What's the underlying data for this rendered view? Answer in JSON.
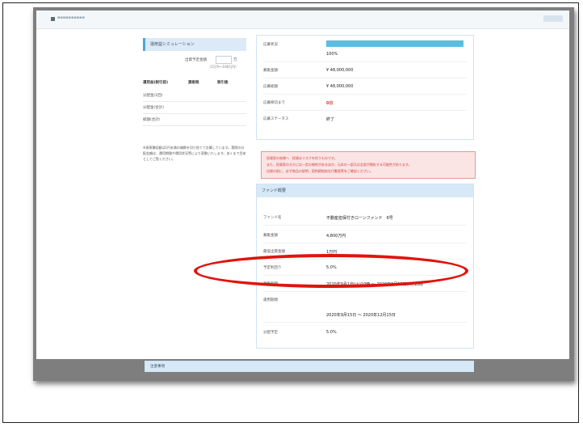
{
  "page": {
    "logo_text": "▪▪▪▪▪▪▪▪▪▪",
    "topbar_right": ""
  },
  "simulation": {
    "title": "運用益シミュレーション",
    "amount_label": "出資予定金額",
    "amount_value": "",
    "amount_unit": "万",
    "amount_note": "（1万円〜100万円）",
    "columns": [
      "運用益(税引前)",
      "源泉税",
      "税引後"
    ],
    "rows": [
      {
        "label": "分配金(1回)",
        "c2": "",
        "c3": ""
      },
      {
        "label": "分配金(合計)",
        "c2": "",
        "c3": ""
      },
      {
        "label": "総額(合計)",
        "c2": "",
        "c3": ""
      }
    ],
    "note": "※源泉徴収額は1円未満の端数を切り捨てて計算しています。実際の分配金額は、運用期間や運用状況等により変動いたします。あくまで目安としてご覧ください。"
  },
  "progress_card": {
    "fill_percent": 100,
    "rows": [
      {
        "label": "応募状況",
        "value": ""
      },
      {
        "label": "",
        "value": "100%"
      },
      {
        "label": "募集金額",
        "value": "¥ 48,000,000"
      },
      {
        "label": "応募総額",
        "value": "¥ 48,000,000"
      },
      {
        "label": "応募締切まで",
        "value": "0日"
      },
      {
        "label": "応募ステータス",
        "value": "終了"
      }
    ]
  },
  "alert": {
    "lines": [
      "投資家の皆様へ　投資はリスクを伴うものです。",
      "また、投資家の方々には一定の制約があるほか、元本の一部又は全部が損失する可能性があります。",
      "出資の前に、必ず商品の説明、契約締結前交付書面等をご確認ください。"
    ]
  },
  "fund_card": {
    "title": "ファンド概要",
    "rows": [
      {
        "label": "ファンド名",
        "value": "不動産担保付きローンファンド　6号"
      },
      {
        "label": "募集金額",
        "value": "4,800万円"
      },
      {
        "label": "最低出資金額",
        "value": "1万円"
      },
      {
        "label": "予定利回り",
        "value": "5.0%"
      },
      {
        "label": "募集期間",
        "value": "2020年9月1日(火)10時 〜 2020年9月10日(木)18時"
      },
      {
        "label": "運用期間",
        "value": ""
      },
      {
        "label": "",
        "value": "2020年9月15日 〜 2020年12月15日"
      },
      {
        "label": "分配予定",
        "value": "5.0%"
      }
    ]
  },
  "bottom_section": {
    "title": "注意事項"
  },
  "colors": {
    "progress_fill": "#5bbde0",
    "highlight": "#e0140c",
    "alert_text": "#d33a3a"
  }
}
